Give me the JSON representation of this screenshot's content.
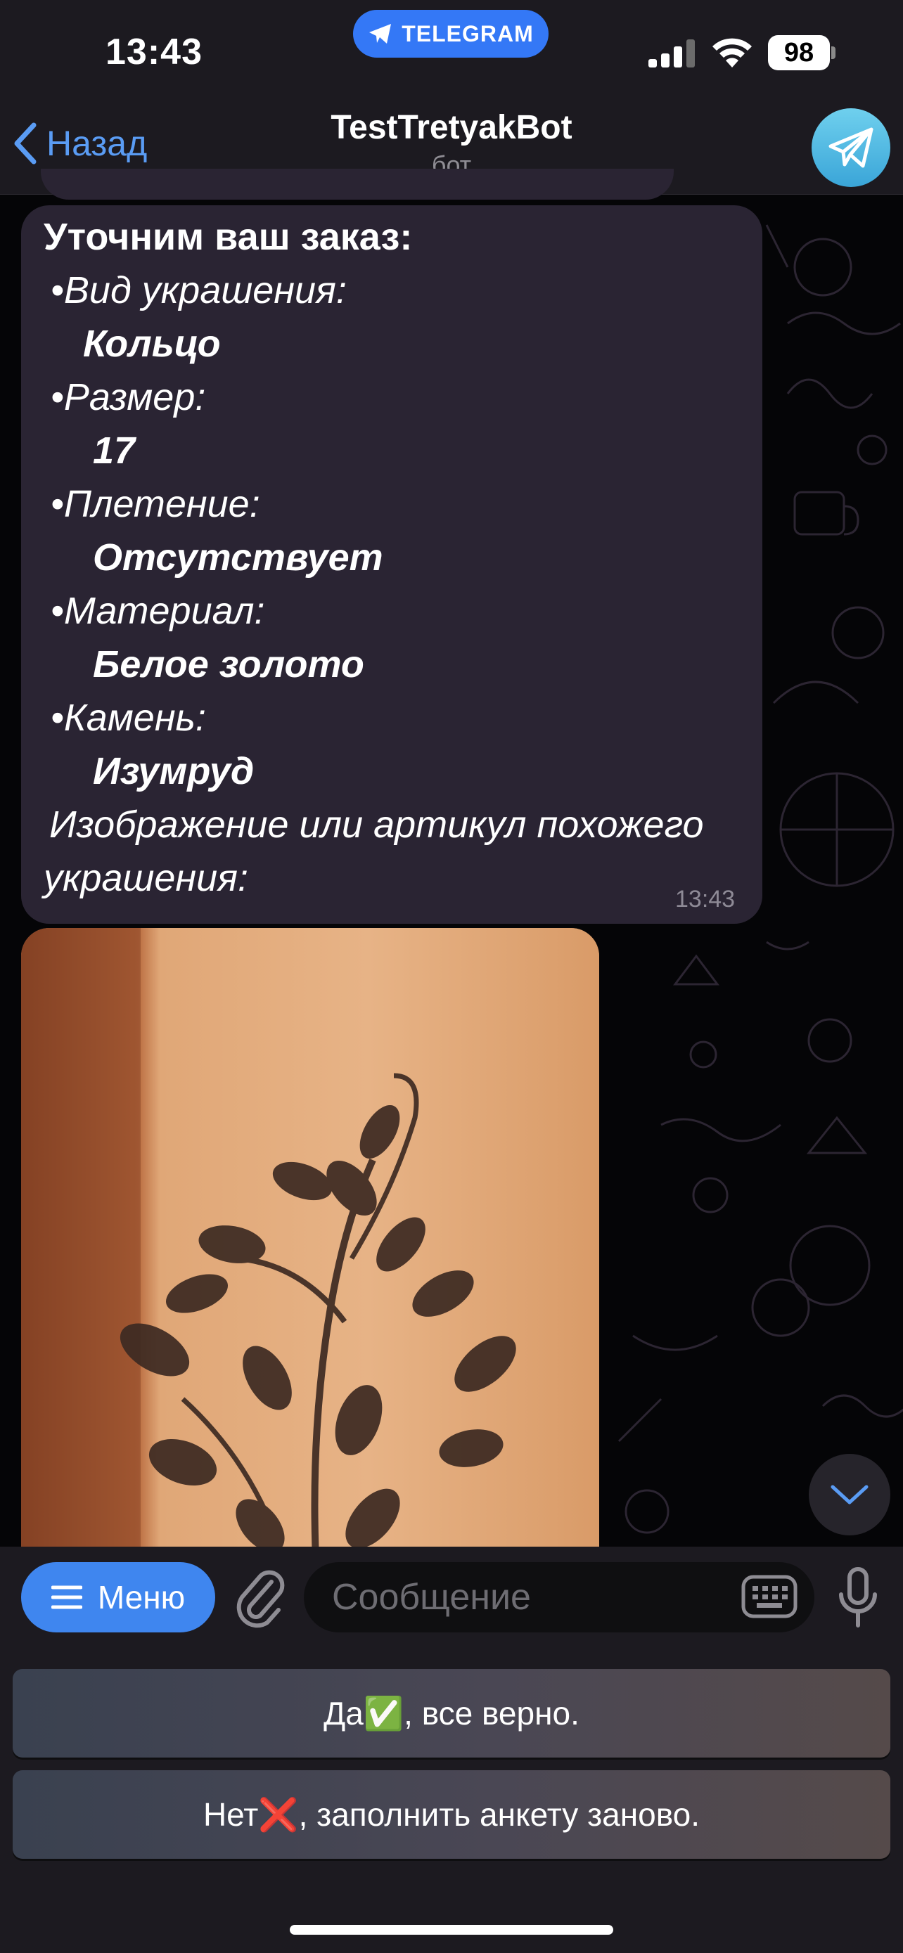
{
  "status_bar": {
    "time": "13:43",
    "app_pill": "TELEGRAM",
    "battery": "98"
  },
  "header": {
    "back_label": "Назад",
    "title": "TestTretyakBot",
    "subtitle": "бот"
  },
  "message": {
    "heading": "Уточним ваш заказ:",
    "items": [
      {
        "label": "•Вид украшения:",
        "value": "Кольцо"
      },
      {
        "label": "•Размер:",
        "value": "17"
      },
      {
        "label": "•Плетение:",
        "value": "Отсутствует"
      },
      {
        "label": "•Материал:",
        "value": "Белое золото"
      },
      {
        "label": "•Камень:",
        "value": "Изумруд"
      }
    ],
    "footer_line1": "Изображение или артикул похожего",
    "footer_line2": "украшения:",
    "time": "13:43"
  },
  "input_bar": {
    "menu_label": "Меню",
    "placeholder": "Сообщение"
  },
  "keyboard": {
    "yes_button": "Да✅, все верно.",
    "no_button": "Нет❌, заполнить анкету заново."
  },
  "colors": {
    "accent": "#3f86ef",
    "bubble": "#2a2433",
    "bar": "#1c1a20"
  }
}
